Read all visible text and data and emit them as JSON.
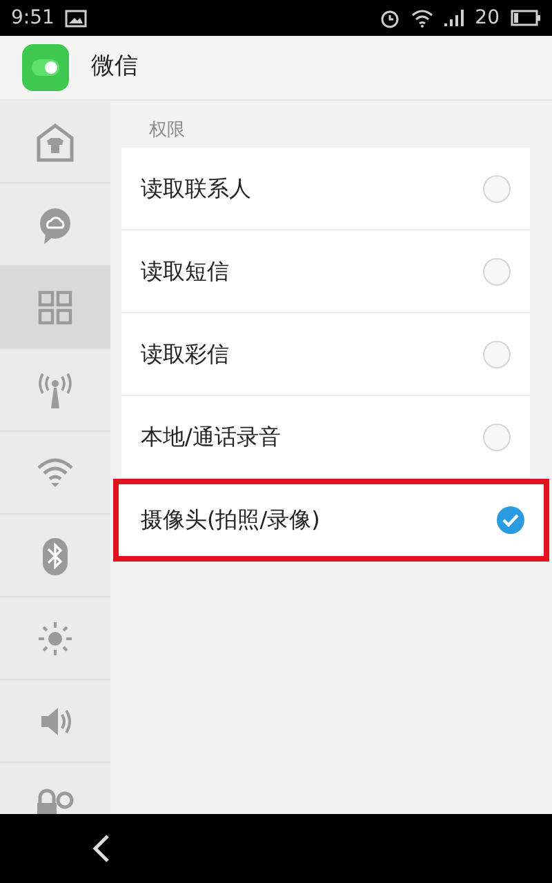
{
  "status_bar": {
    "time": "9:51",
    "signal_label": "20"
  },
  "header": {
    "title": "微信"
  },
  "sidebar": {
    "items": [
      {
        "selected": false
      },
      {
        "selected": false
      },
      {
        "selected": true
      },
      {
        "selected": false
      },
      {
        "selected": false
      },
      {
        "selected": false
      },
      {
        "selected": false
      },
      {
        "selected": false
      },
      {
        "selected": false
      }
    ]
  },
  "section_title": "权限",
  "permissions": [
    {
      "label": "读取联系人",
      "checked": false,
      "highlighted": false
    },
    {
      "label": "读取短信",
      "checked": false,
      "highlighted": false
    },
    {
      "label": "读取彩信",
      "checked": false,
      "highlighted": false
    },
    {
      "label": "本地/通话录音",
      "checked": false,
      "highlighted": false
    },
    {
      "label": "摄像头(拍照/录像)",
      "checked": true,
      "highlighted": true
    }
  ]
}
